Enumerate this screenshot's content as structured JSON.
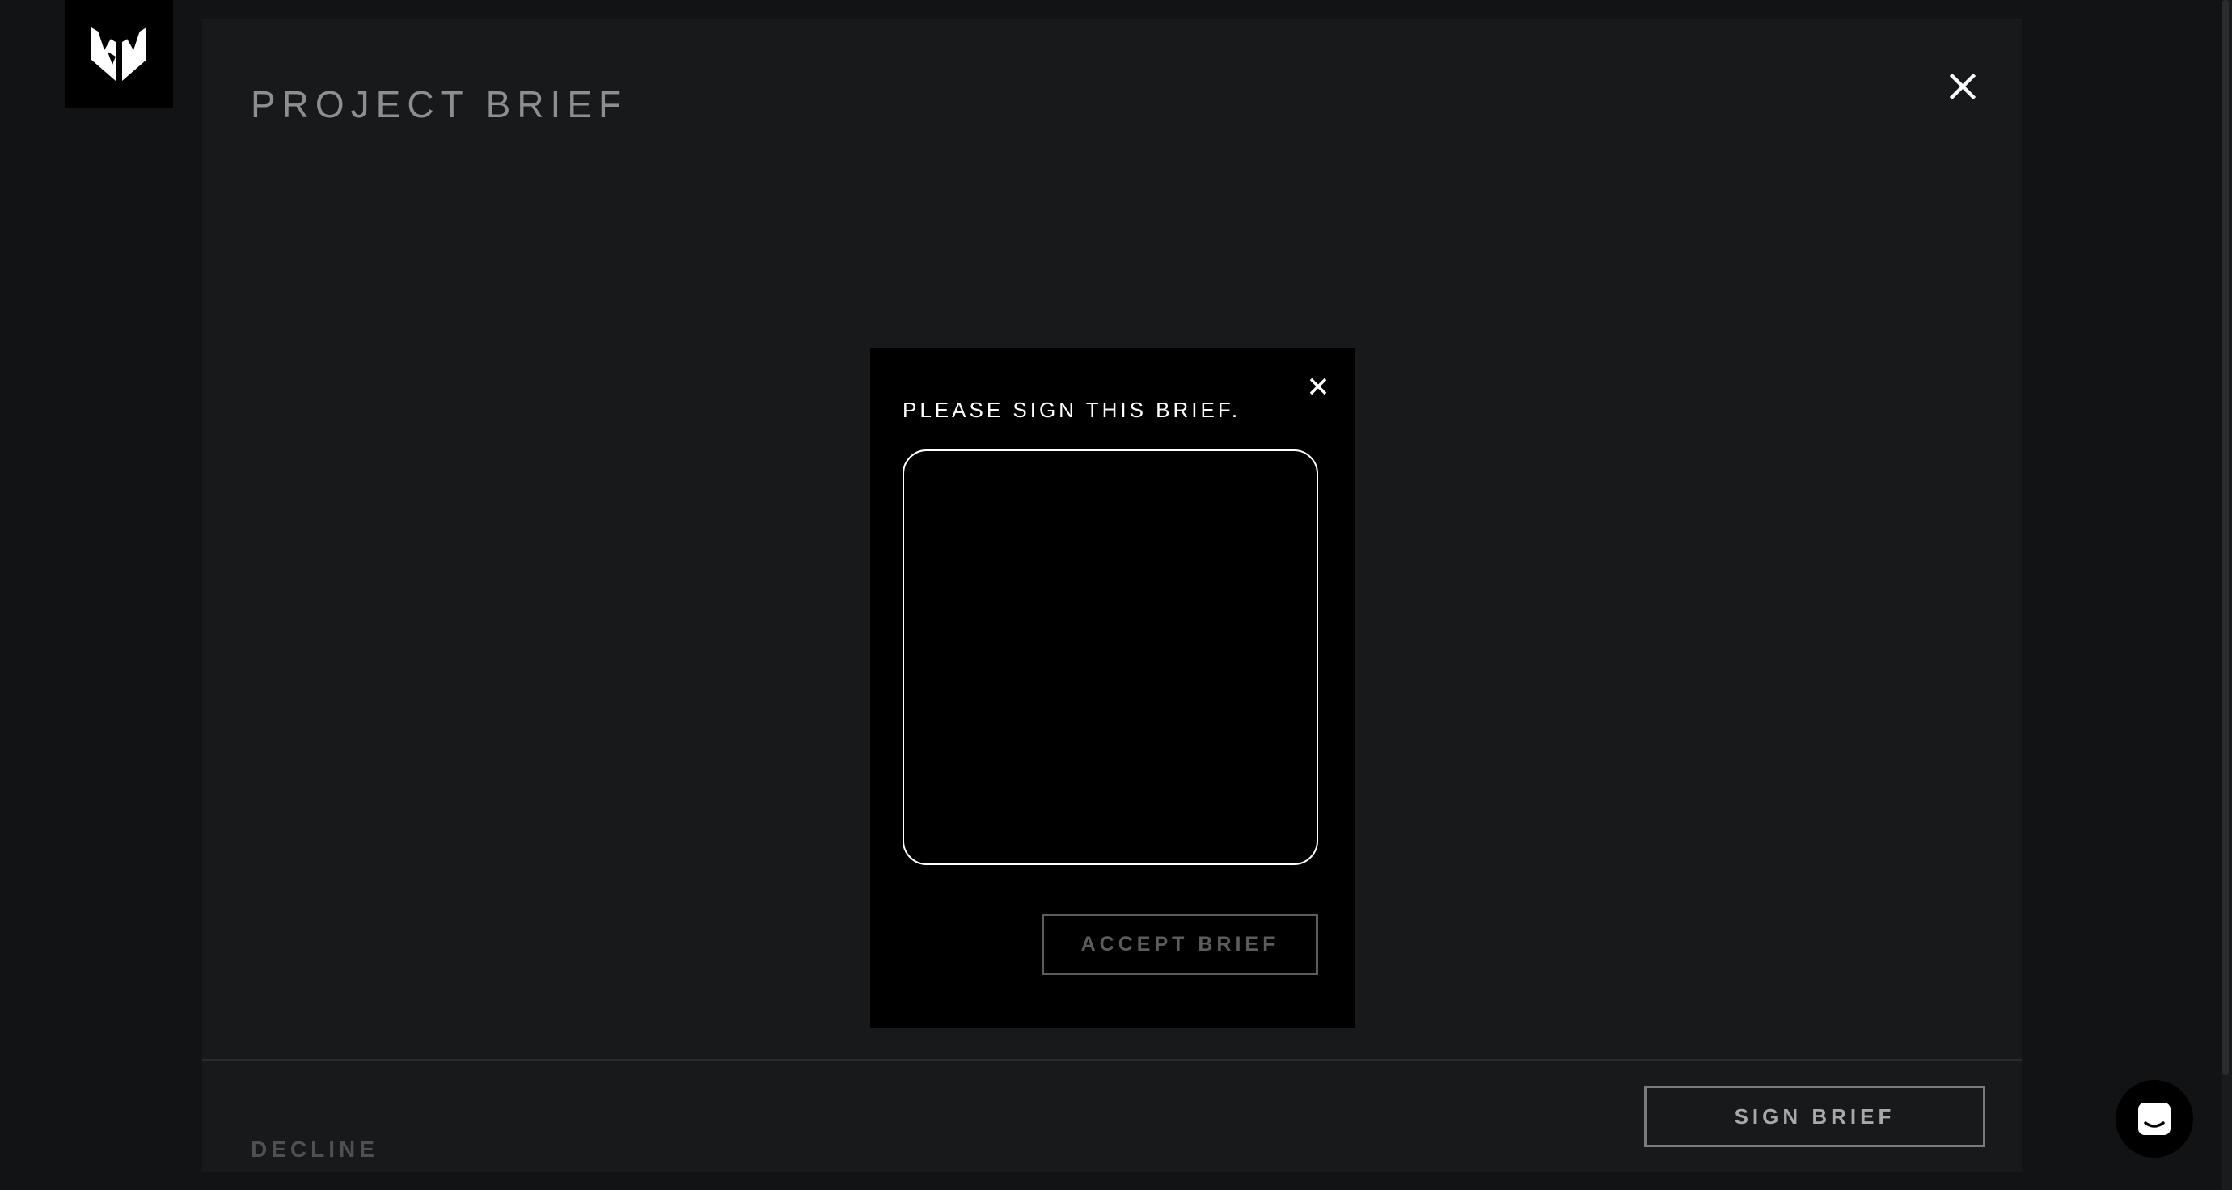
{
  "panel": {
    "title": "PROJECT BRIEF",
    "close_icon": "close-icon"
  },
  "modal": {
    "heading": "PLEASE SIGN THIS BRIEF.",
    "accept_label": "ACCEPT BRIEF",
    "close_icon": "close-icon"
  },
  "footer": {
    "decline_label": "DECLINE",
    "sign_label": "SIGN BRIEF"
  },
  "logo": {
    "icon": "brand-logo-icon"
  },
  "chat": {
    "icon": "chat-icon"
  },
  "colors": {
    "background": "#121315",
    "panel": "#18191b",
    "modal": "#000000",
    "text_muted": "#8d8e90",
    "accent": "#ffffff"
  }
}
